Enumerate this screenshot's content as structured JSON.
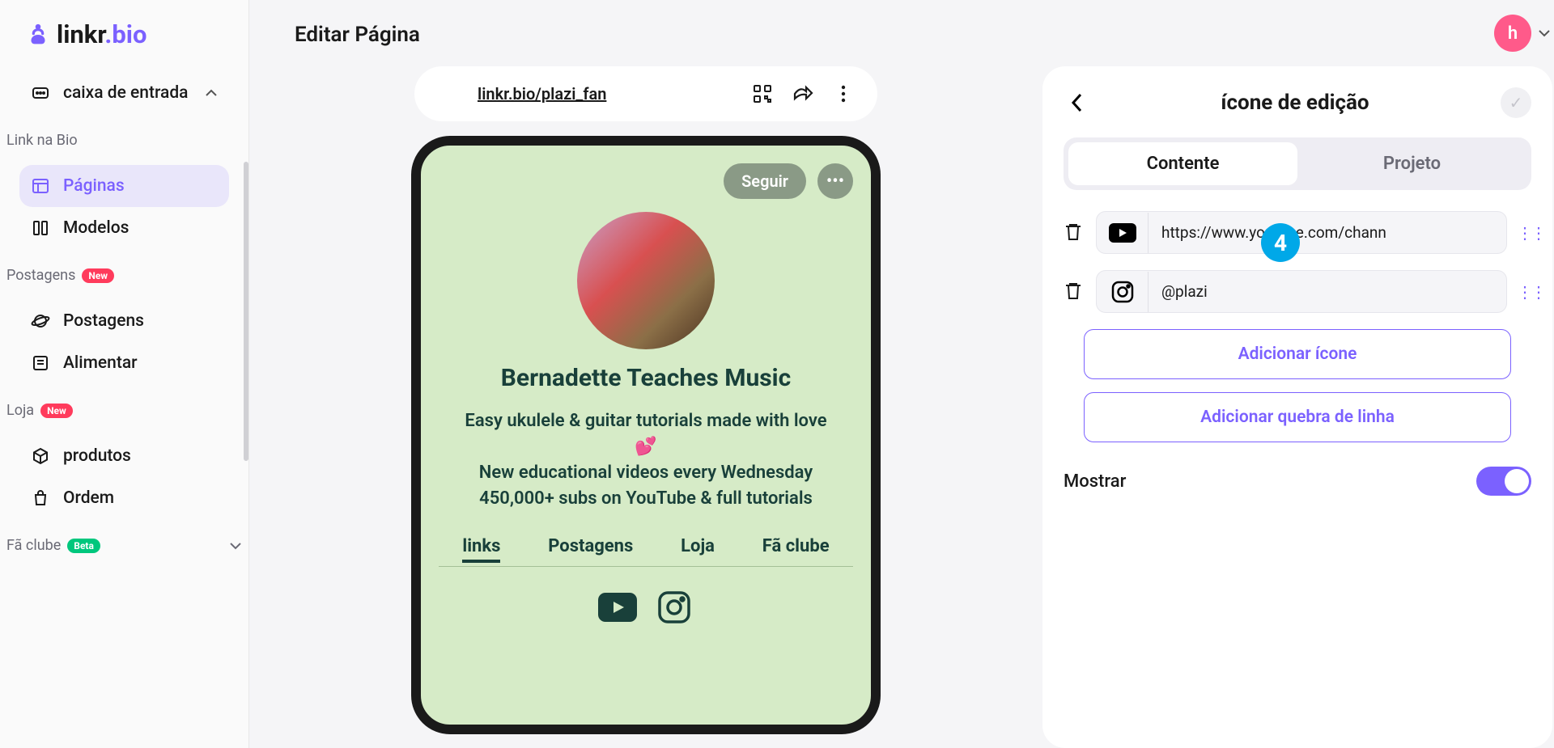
{
  "brand": {
    "name_a": "linkr",
    "name_b": ".bio"
  },
  "header": {
    "title": "Editar Página",
    "avatar_letter": "h"
  },
  "sidebar": {
    "inbox": "caixa de entrada",
    "section_linkbio": "Link na Bio",
    "pages": "Páginas",
    "models": "Modelos",
    "section_posts": "Postagens",
    "badge_new": "New",
    "posts": "Postagens",
    "feed": "Alimentar",
    "section_store": "Loja",
    "products": "produtos",
    "orders": "Ordem",
    "fanclub": "Fã clube",
    "badge_beta": "Beta"
  },
  "urlbar": {
    "link": "linkr.bio/plazi_fan"
  },
  "profile": {
    "follow": "Seguir",
    "name": "Bernadette Teaches Music",
    "bio1": "Easy ukulele & guitar tutorials made with love 💕",
    "bio2": "New educational videos every Wednesday",
    "bio3": "450,000+ subs on YouTube & full tutorials",
    "tabs": {
      "links": "links",
      "posts": "Postagens",
      "store": "Loja",
      "fanclub": "Fã clube"
    }
  },
  "step": "4",
  "panel": {
    "title": "ícone de edição",
    "tab_content": "Contente",
    "tab_project": "Projeto",
    "rows": [
      {
        "value": "https://www.youtube.com/chann"
      },
      {
        "value": "@plazi"
      }
    ],
    "add_icon": "Adicionar ícone",
    "add_break": "Adicionar quebra de linha",
    "show": "Mostrar"
  }
}
